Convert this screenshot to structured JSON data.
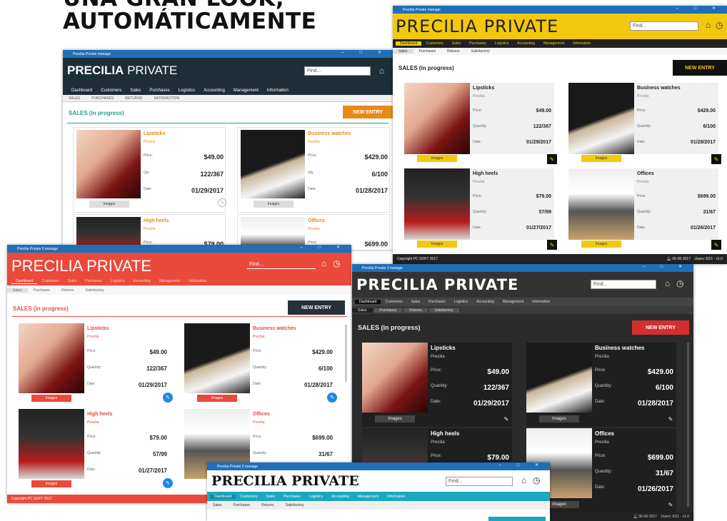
{
  "headline": {
    "line1": "UNA GRAN LOOK,",
    "line2": "AUTOMÁTICAMENTE"
  },
  "app": {
    "title": "Precilia Private manage",
    "logo_bold": "PRECILIA",
    "logo_rest": " PRIVATE",
    "logo_full": "PRECILIA PRIVATE",
    "find": "Find...",
    "nav": [
      "Dashboard",
      "Customers",
      "Sales",
      "Purchases",
      "Logistics",
      "Accounting",
      "Management",
      "Information"
    ],
    "subnav_upper": [
      "SALES",
      "PURCHASES",
      "RETURNS",
      "SATISFACTION"
    ],
    "subnav": [
      "Sales",
      "Purchases",
      "Returns",
      "Satisfactory"
    ],
    "section": "SALES (in progress)",
    "new_entry": "NEW ENTRY",
    "images": "Images",
    "copyright": "Copyright PC SOFT 2017",
    "date": "06-06-2017",
    "users": "Users: 6/21 - v1.0"
  },
  "windows": {
    "w1": {
      "title": "Precilia Private manage"
    },
    "w2": {
      "title": "Precilia Private manage"
    },
    "w3": {
      "title": "Precilia Private 5 manage"
    },
    "w4": {
      "title": "Precilia Private 3 manage"
    },
    "w5": {
      "title": "Precilia Private 2 manage"
    }
  },
  "labels": {
    "price": "Price:",
    "qty": "Qty",
    "quantity": "Quantity:",
    "date": "Date:"
  },
  "products": [
    {
      "name": "Lipsticks",
      "brand": "Precilia",
      "price": "$49.00",
      "qty": "122/367",
      "date": "01/29/2017"
    },
    {
      "name": "Business watches",
      "brand": "Precilia",
      "price": "$429.00",
      "qty": "6/100",
      "date": "01/28/2017"
    },
    {
      "name": "High heels",
      "brand": "Precilia",
      "price": "$79.00",
      "qty": "57/99",
      "date": "01/27/2017"
    },
    {
      "name": "Offices",
      "brand": "Precilia",
      "price": "$699.00",
      "qty": "31/67",
      "date": "01/26/2017"
    }
  ],
  "colors": {
    "teal": "#1a3c4f",
    "yellow": "#f2c80f",
    "red": "#e94a3c",
    "dark": "#2a2a2a",
    "orange": "#e8891a",
    "cyan": "#1ba7bf"
  }
}
